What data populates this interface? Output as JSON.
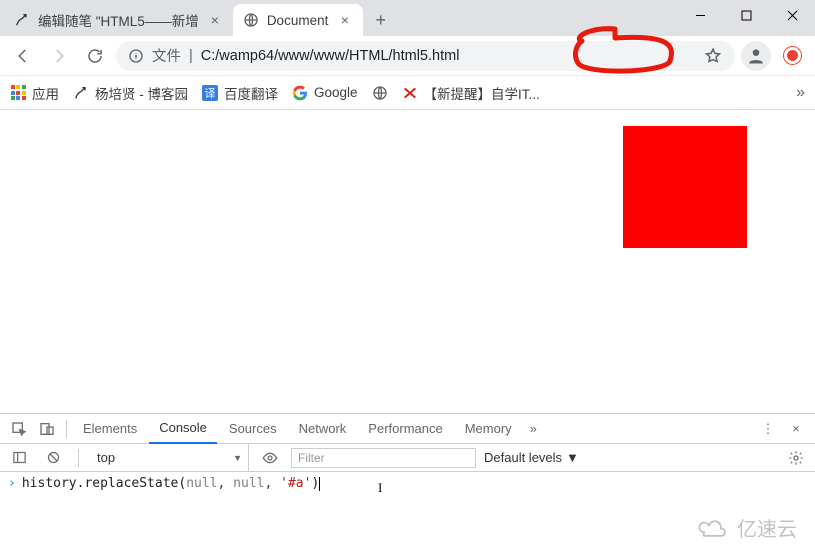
{
  "window": {
    "tabs": [
      {
        "title": "编辑随笔 \"HTML5——新增",
        "active": false
      },
      {
        "title": "Document",
        "active": true
      }
    ]
  },
  "address": {
    "protocol_label": "文件",
    "url": "C:/wamp64/www/www/HTML/html5.html"
  },
  "bookmarks": {
    "apps_label": "应用",
    "items": [
      "杨培贤 - 博客园",
      "百度翻译",
      "Google",
      "",
      "【新提醒】自学IT..."
    ]
  },
  "page": {
    "red_box_color": "#ff0000"
  },
  "devtools": {
    "tabs": [
      "Elements",
      "Console",
      "Sources",
      "Network",
      "Performance",
      "Memory"
    ],
    "active_tab": "Console",
    "context": "top",
    "filter_placeholder": "Filter",
    "levels_label": "Default levels",
    "console_input": {
      "prefix": "history.replaceState(",
      "arg_null_1": "null",
      "sep1": ", ",
      "arg_null_2": "null",
      "sep2": ", ",
      "arg_str": "'#a'",
      "suffix": ")"
    }
  },
  "watermark": "亿速云"
}
